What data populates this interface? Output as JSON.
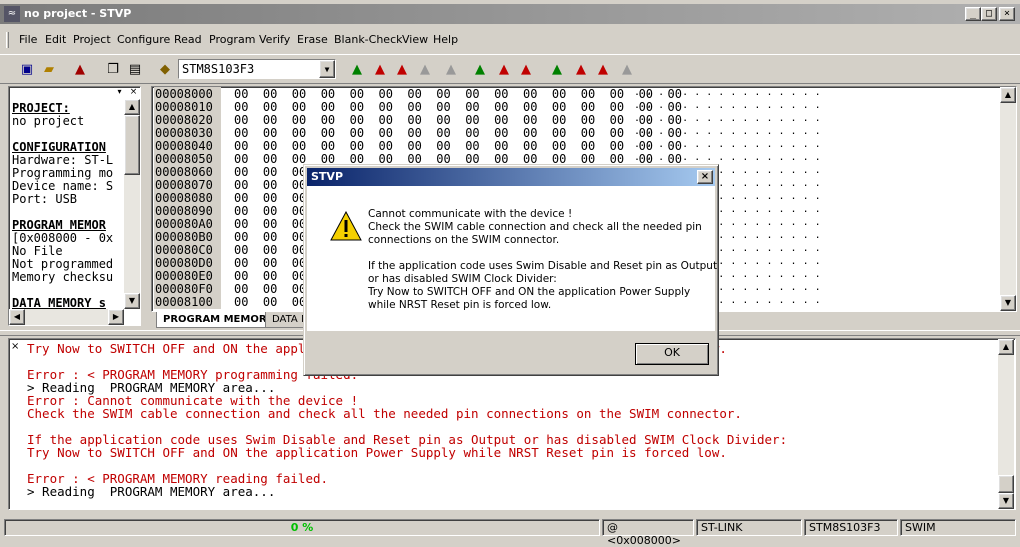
{
  "window": {
    "title": "no project - STVP"
  },
  "menu": [
    "File",
    "Edit",
    "Project",
    "Configure",
    "Read",
    "Program",
    "Verify",
    "Erase",
    "Blank-Check",
    "View",
    "Help"
  ],
  "toolbar": {
    "device": "STM8S103F3"
  },
  "project_panel": [
    {
      "text": "PROJECT:",
      "bold": true
    },
    {
      "text": "no project"
    },
    {
      "text": ""
    },
    {
      "text": "CONFIGURATION",
      "bold": true
    },
    {
      "text": "Hardware: ST-L"
    },
    {
      "text": "Programming mo"
    },
    {
      "text": "Device name: S"
    },
    {
      "text": "Port: USB"
    },
    {
      "text": ""
    },
    {
      "text": "PROGRAM MEMOR",
      "bold": true
    },
    {
      "text": "[0x008000 - 0x"
    },
    {
      "text": "No File"
    },
    {
      "text": "Not programmed"
    },
    {
      "text": "Memory checksu"
    },
    {
      "text": ""
    },
    {
      "text": "DATA MEMORY s",
      "bold": true
    }
  ],
  "hex": {
    "addresses": [
      "00008000",
      "00008010",
      "00008020",
      "00008030",
      "00008040",
      "00008050",
      "00008060",
      "00008070",
      "00008080",
      "00008090",
      "000080A0",
      "000080B0",
      "000080C0",
      "000080D0",
      "000080E0",
      "000080F0",
      "00008100"
    ],
    "row_bytes": "00  00  00  00  00  00  00  00  00  00  00  00  00  00  00  00",
    "ascii": ". . . . . . . . . . . . . . . ."
  },
  "tabs": [
    "PROGRAM MEMORY",
    "DATA M"
  ],
  "log": [
    {
      "text": "Try Now to SWITCH OFF and ON the application Power Supply while NRST Reset pin is forced low.",
      "color": "#c00000"
    },
    {
      "text": "",
      "color": "#000"
    },
    {
      "text": "Error : < PROGRAM MEMORY programming failed.",
      "color": "#c00000"
    },
    {
      "text": "> Reading  PROGRAM MEMORY area...",
      "color": "#000000"
    },
    {
      "text": "Error : Cannot communicate with the device !",
      "color": "#c00000"
    },
    {
      "text": "Check the SWIM cable connection and check all the needed pin connections on the SWIM connector.",
      "color": "#c00000"
    },
    {
      "text": "",
      "color": "#000"
    },
    {
      "text": "If the application code uses Swim Disable and Reset pin as Output or has disabled SWIM Clock Divider:",
      "color": "#c00000"
    },
    {
      "text": "Try Now to SWITCH OFF and ON the application Power Supply while NRST Reset pin is forced low.",
      "color": "#c00000"
    },
    {
      "text": "",
      "color": "#000"
    },
    {
      "text": "Error : < PROGRAM MEMORY reading failed.",
      "color": "#c00000"
    },
    {
      "text": "> Reading  PROGRAM MEMORY area...",
      "color": "#000000"
    }
  ],
  "status": {
    "progress": "0 %",
    "address": "@ <0x008000>",
    "tool": "ST-LINK",
    "device": "STM8S103F3",
    "protocol": "SWIM"
  },
  "dialog": {
    "title": "STVP",
    "lines": [
      "Cannot communicate with the device !",
      "Check the SWIM cable connection and check all the needed pin",
      "connections on the SWIM connector.",
      "",
      "If the application code uses Swim Disable and Reset pin as Output",
      "or has disabled SWIM Clock Divider:",
      "Try Now to SWITCH OFF and ON the application Power Supply",
      "while NRST Reset pin is forced low."
    ],
    "ok_label": "OK"
  }
}
